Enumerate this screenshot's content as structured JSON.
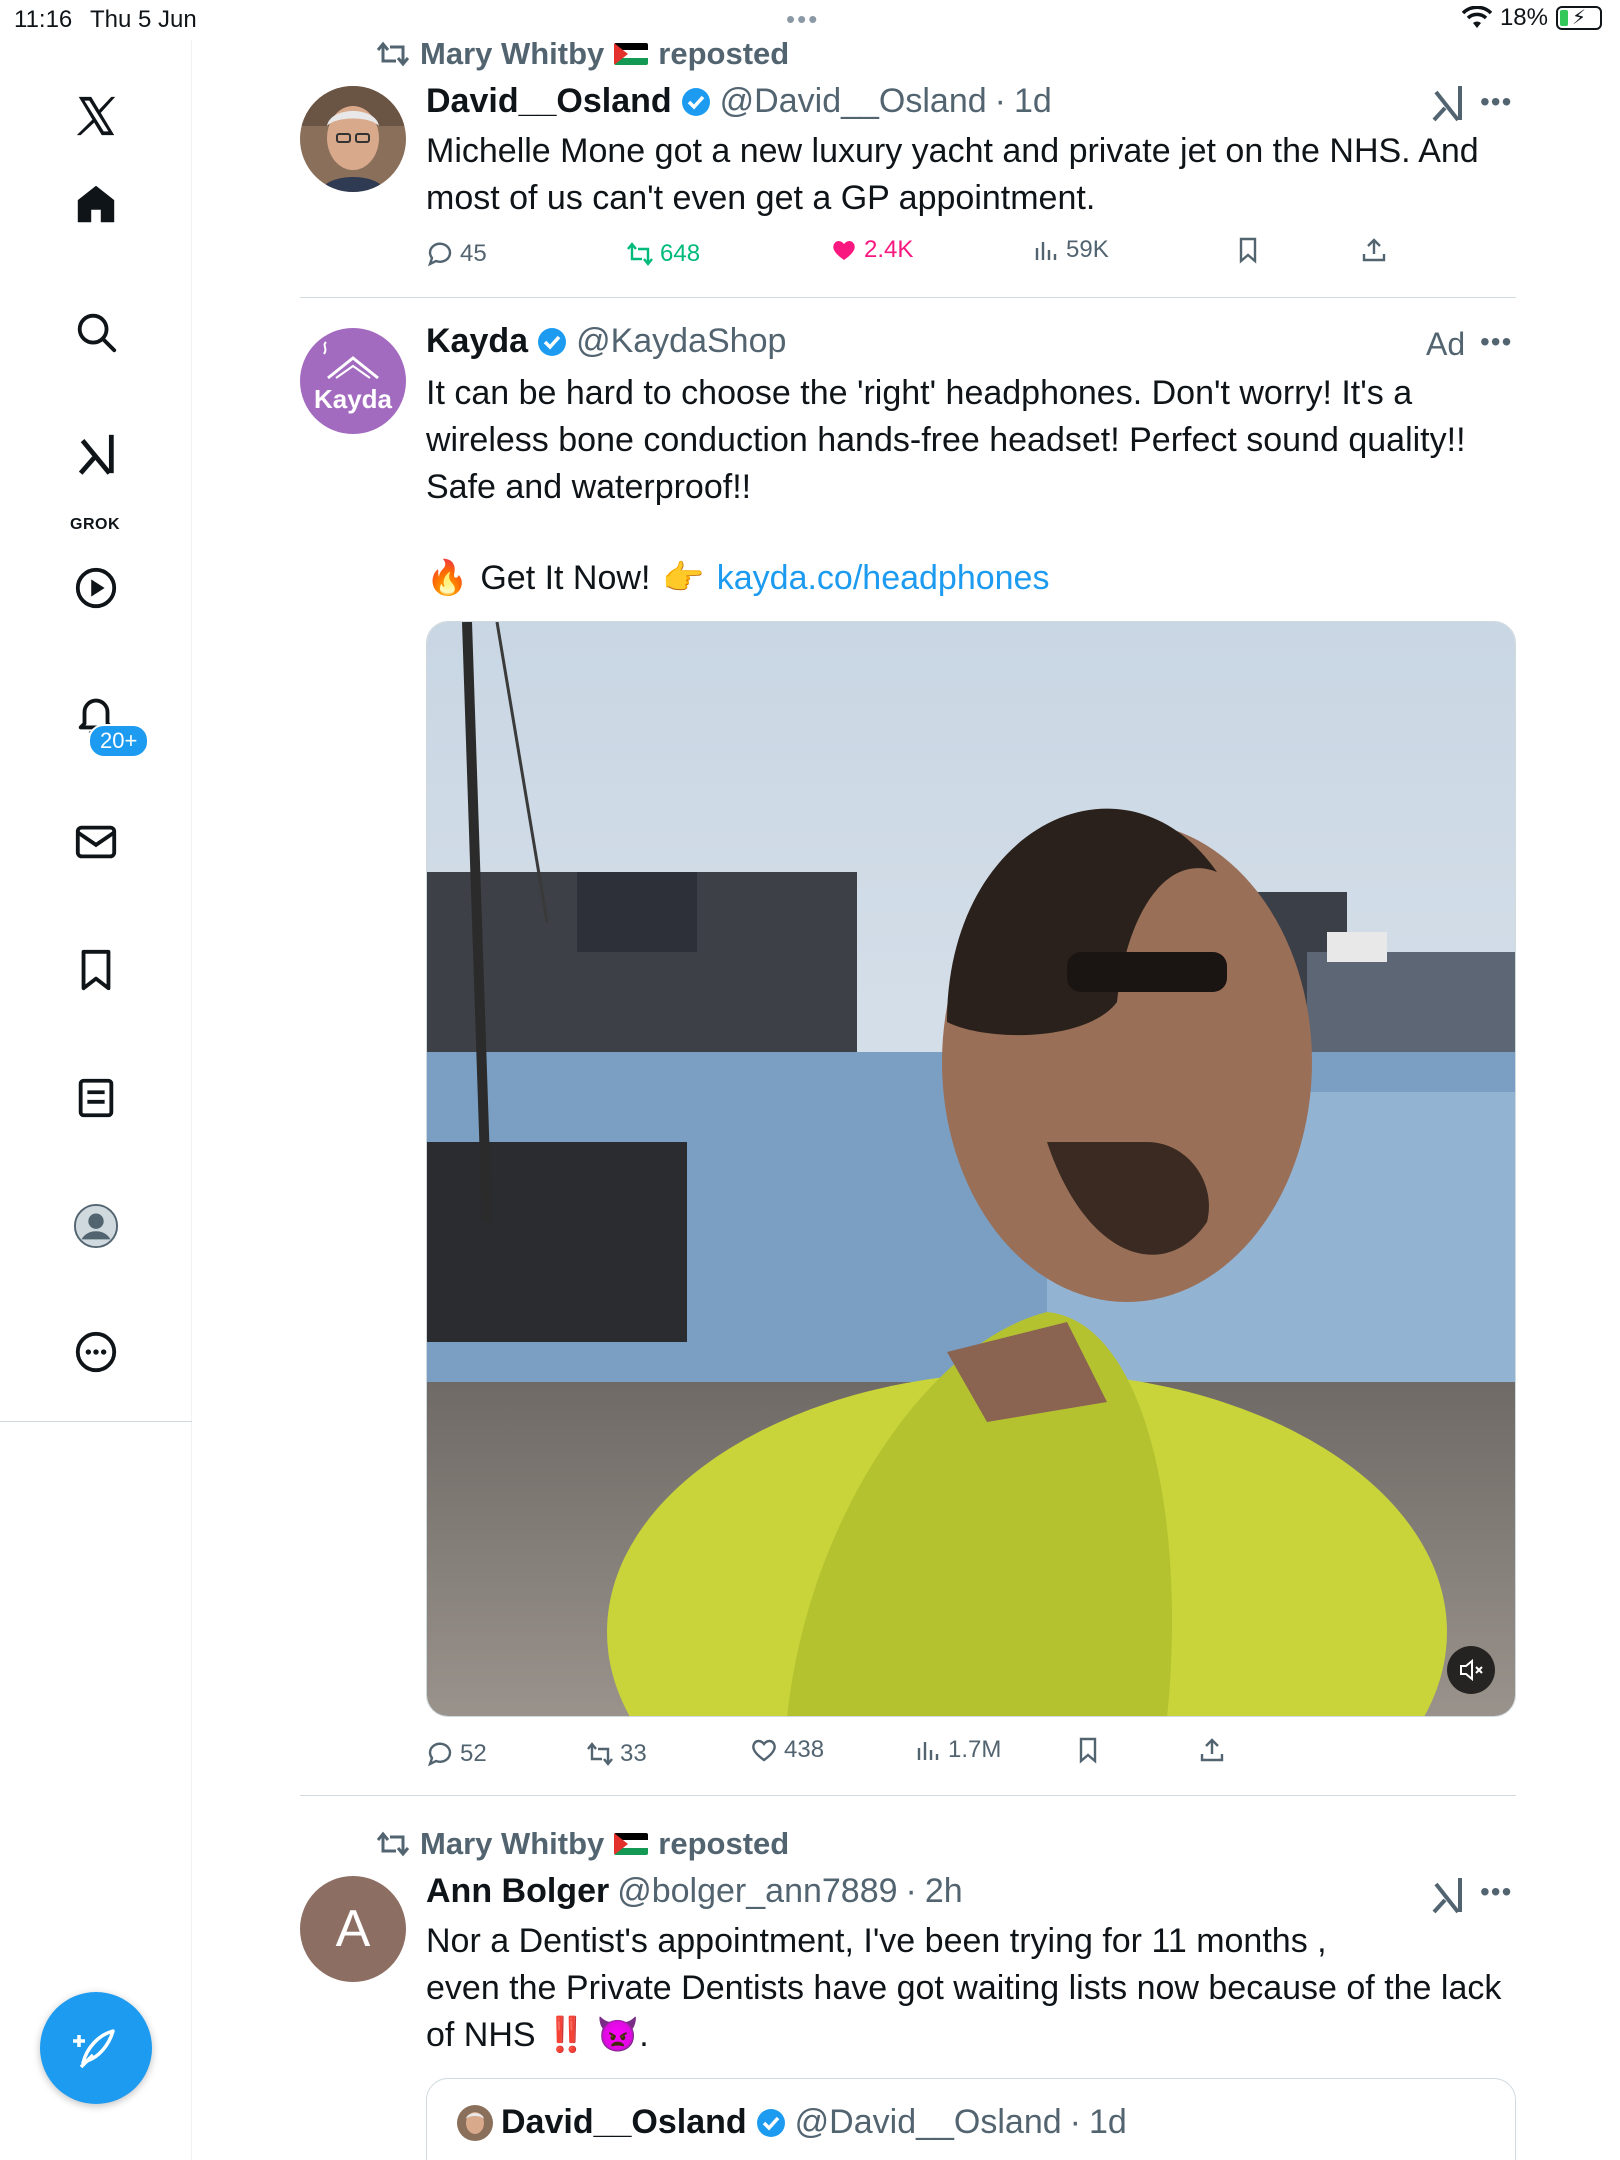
{
  "status_bar": {
    "time": "11:16",
    "date": "Thu 5 Jun",
    "battery": "18%"
  },
  "sidebar": {
    "notifications_badge": "20+",
    "grok_label": "GROK",
    "items": [
      "home-icon",
      "search-icon",
      "grok-icon",
      "video-icon",
      "notifications-icon",
      "messages-icon",
      "bookmarks-icon",
      "lists-icon",
      "profile-icon",
      "more-icon"
    ]
  },
  "colors": {
    "accent": "#1d9bf0",
    "like": "#f91880",
    "repost": "#00ba7c"
  },
  "tweets": [
    {
      "repost_by": "Mary Whitby",
      "repost_suffix": "reposted",
      "name": "David__Osland",
      "handle": "@David__Osland",
      "sep": "·",
      "time": "1d",
      "text": "Michelle Mone got a new luxury yacht and private jet on the NHS. And most of us can't even get a GP appointment.",
      "replies": "45",
      "reposts": "648",
      "likes": "2.4K",
      "views": "59K"
    },
    {
      "name": "Kayda",
      "handle": "@KaydaShop",
      "ad_label": "Ad",
      "avatar_text": "Kayda",
      "text": "It can be hard to choose the 'right' headphones. Don't worry! It's a wireless bone conduction hands-free headset! Perfect sound quality!! Safe and waterproof!!",
      "cta_text": "Get It Now!",
      "link": "kayda.co/headphones",
      "replies": "52",
      "reposts": "33",
      "likes": "438",
      "views": "1.7M"
    },
    {
      "repost_by": "Mary Whitby",
      "repost_suffix": "reposted",
      "name": "Ann Bolger",
      "handle": "@bolger_ann7889",
      "sep": "·",
      "time": "2h",
      "avatar_letter": "A",
      "text_line1": "Nor a Dentist's appointment, I've been trying for 11 months ,",
      "text_line2": "even the Private Dentists have got waiting lists now because of the lack",
      "text_line3": "of NHS",
      "text_end": ".",
      "quote": {
        "name": "David__Osland",
        "handle": "@David__Osland",
        "sep": "·",
        "time": "1d"
      }
    }
  ]
}
